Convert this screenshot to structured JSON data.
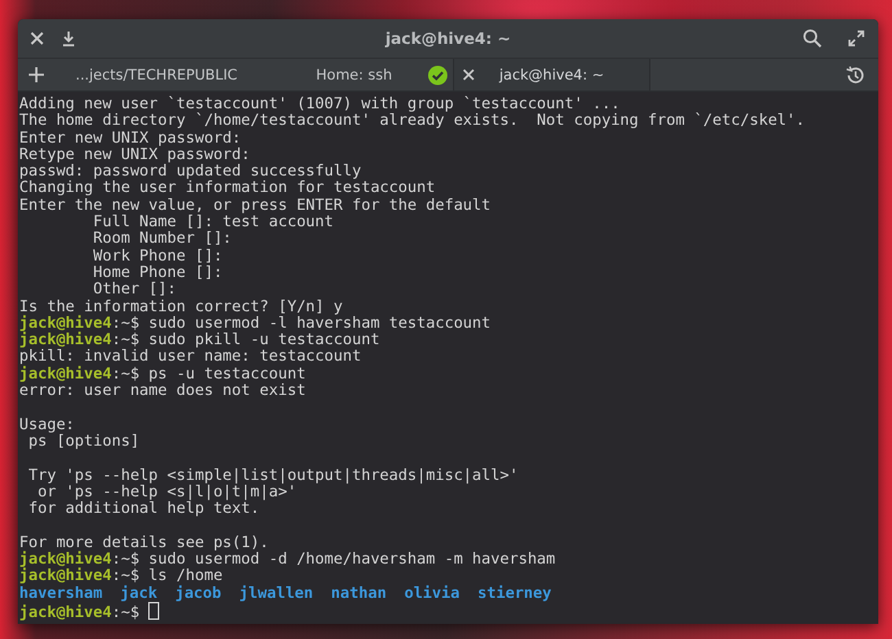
{
  "window": {
    "title": "jack@hive4: ~"
  },
  "tabs": [
    {
      "label": "...jects/TECHREPUBLIC",
      "selected": false,
      "finished": false
    },
    {
      "label": "Home: ssh",
      "selected": false,
      "finished": true
    },
    {
      "label": "jack@hive4: ~",
      "selected": true,
      "finished": false
    }
  ],
  "terminal": {
    "lines": [
      {
        "kind": "output",
        "text": "Adding new user `testaccount' (1007) with group `testaccount' ..."
      },
      {
        "kind": "output",
        "text": "The home directory `/home/testaccount' already exists.  Not copying from `/etc/skel'."
      },
      {
        "kind": "output",
        "text": "Enter new UNIX password:"
      },
      {
        "kind": "output",
        "text": "Retype new UNIX password:"
      },
      {
        "kind": "output",
        "text": "passwd: password updated successfully"
      },
      {
        "kind": "output",
        "text": "Changing the user information for testaccount"
      },
      {
        "kind": "output",
        "text": "Enter the new value, or press ENTER for the default"
      },
      {
        "kind": "output",
        "text": "        Full Name []: test account"
      },
      {
        "kind": "output",
        "text": "        Room Number []:"
      },
      {
        "kind": "output",
        "text": "        Work Phone []:"
      },
      {
        "kind": "output",
        "text": "        Home Phone []:"
      },
      {
        "kind": "output",
        "text": "        Other []:"
      },
      {
        "kind": "output",
        "text": "Is the information correct? [Y/n] y"
      },
      {
        "kind": "prompt",
        "user_host": "jack@hive4",
        "path": ":~$",
        "command": "sudo usermod -l haversham testaccount",
        "cursor": false
      },
      {
        "kind": "prompt",
        "user_host": "jack@hive4",
        "path": ":~$",
        "command": "sudo pkill -u testaccount",
        "cursor": false
      },
      {
        "kind": "output",
        "text": "pkill: invalid user name: testaccount"
      },
      {
        "kind": "prompt",
        "user_host": "jack@hive4",
        "path": ":~$",
        "command": "ps -u testaccount",
        "cursor": false
      },
      {
        "kind": "output",
        "text": "error: user name does not exist"
      },
      {
        "kind": "blank"
      },
      {
        "kind": "output",
        "text": "Usage:"
      },
      {
        "kind": "output",
        "text": " ps [options]"
      },
      {
        "kind": "blank"
      },
      {
        "kind": "output",
        "text": " Try 'ps --help <simple|list|output|threads|misc|all>'"
      },
      {
        "kind": "output",
        "text": "  or 'ps --help <s|l|o|t|m|a>'"
      },
      {
        "kind": "output",
        "text": " for additional help text."
      },
      {
        "kind": "blank"
      },
      {
        "kind": "output",
        "text": "For more details see ps(1)."
      },
      {
        "kind": "prompt",
        "user_host": "jack@hive4",
        "path": ":~$",
        "command": "sudo usermod -d /home/haversham -m haversham",
        "cursor": false
      },
      {
        "kind": "prompt",
        "user_host": "jack@hive4",
        "path": ":~$",
        "command": "ls /home",
        "cursor": false
      },
      {
        "kind": "listing",
        "items": [
          "haversham",
          "jack",
          "jacob",
          "jlwallen",
          "nathan",
          "olivia",
          "stierney"
        ]
      },
      {
        "kind": "prompt",
        "user_host": "jack@hive4",
        "path": ":~$",
        "cursor": true
      }
    ]
  }
}
